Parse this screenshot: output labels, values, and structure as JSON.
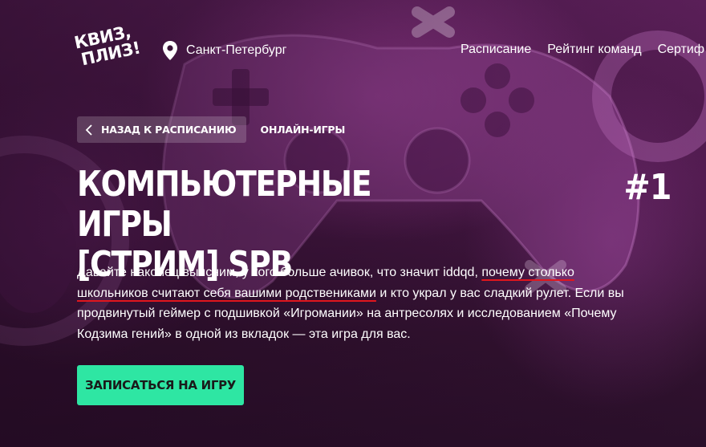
{
  "logo": {
    "line1": "КВИЗ,",
    "line2": "ПЛИЗ!"
  },
  "header": {
    "city": "Санкт-Петербург",
    "nav": [
      "Расписание",
      "Рейтинг команд",
      "Сертиф"
    ]
  },
  "breadcrumbs": {
    "back_label": "НАЗАД К РАСПИСАНИЮ",
    "category": "ОНЛАЙН-ИГРЫ"
  },
  "game": {
    "title_line1": "КОМПЬЮТЕРНЫЕ ИГРЫ",
    "title_line2": "[СТРИМ] SPB",
    "number": "#1"
  },
  "description": {
    "part1": "Давайте наконец выясним, у кого больше ачивок, что значит iddqd, ",
    "highlight": "почему столько школьников считают себя вашими родственикам",
    "highlight_tail": "и",
    "part2": " и кто украл у вас сладкий рулет. Если вы продвинутый геймер с подшивкой «Игромании» на антресолях и исследованием «Почему Кодзима гений» в одной из вкладок — эта игра для вас."
  },
  "cta": {
    "label": "ЗАПИСАТЬСЯ НА ИГРУ"
  },
  "colors": {
    "accent": "#2ee6a3",
    "underline": "#e0161d",
    "background": "#3a1438"
  },
  "icons": [
    "map-pin-icon",
    "chevron-left-icon"
  ]
}
